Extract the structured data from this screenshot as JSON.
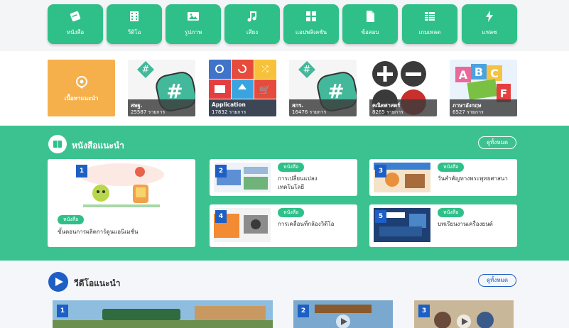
{
  "nav": [
    {
      "label": "หนังสือ",
      "icon": "book-icon"
    },
    {
      "label": "วีดิโอ",
      "icon": "film-icon"
    },
    {
      "label": "รูปภาพ",
      "icon": "image-icon"
    },
    {
      "label": "เสียง",
      "icon": "music-note-icon"
    },
    {
      "label": "แอปพลิเคชัน",
      "icon": "apps-grid-icon"
    },
    {
      "label": "ข้อสอบ",
      "icon": "document-icon"
    },
    {
      "label": "เกมเพลต",
      "icon": "table-icon"
    },
    {
      "label": "แฟลช",
      "icon": "lightning-icon"
    }
  ],
  "categories": [
    {
      "title": "เนื้อหาแนะนำ",
      "count": ""
    },
    {
      "title": "สพฐ.",
      "count": "25587 รายการ"
    },
    {
      "title": "Application",
      "count": "17832 รายการ"
    },
    {
      "title": "สกร.",
      "count": "16476 รายการ"
    },
    {
      "title": "คณิตศาสตร์",
      "count": "8265 รายการ"
    },
    {
      "title": "ภาษาอังกฤษ",
      "count": "6527 รายการ"
    }
  ],
  "books": {
    "title": "หนังสือแนะนำ",
    "view_all": "ดูทั้งหมด",
    "items": [
      {
        "num": "1",
        "badge": "หนังสือ",
        "title": "ขั้นตอนการผลิตการ์ตูนแอนิเมชั่น"
      },
      {
        "num": "2",
        "badge": "หนังสือ",
        "title": "การเปลี่ยนแปลงเทคโนโลยี"
      },
      {
        "num": "3",
        "badge": "หนังสือ",
        "title": "วันสำคัญทางพระพุทธศาสนา"
      },
      {
        "num": "4",
        "badge": "หนังสือ",
        "title": "การเคลื่อนที่กล้องวิดีโอ"
      },
      {
        "num": "5",
        "badge": "หนังสือ",
        "title": "บทเรียนงานเครื่องยนต์"
      }
    ]
  },
  "videos": {
    "title": "วีดีโอแนะนำ",
    "view_all": "ดูทั้งหมด",
    "items": [
      {
        "num": "1"
      },
      {
        "num": "2"
      },
      {
        "num": "3"
      }
    ]
  },
  "colors": {
    "accent": "#3cc290",
    "nav": "#2fc08a",
    "badge_blue": "#1d5fc4",
    "featured": "#f5b04c"
  }
}
